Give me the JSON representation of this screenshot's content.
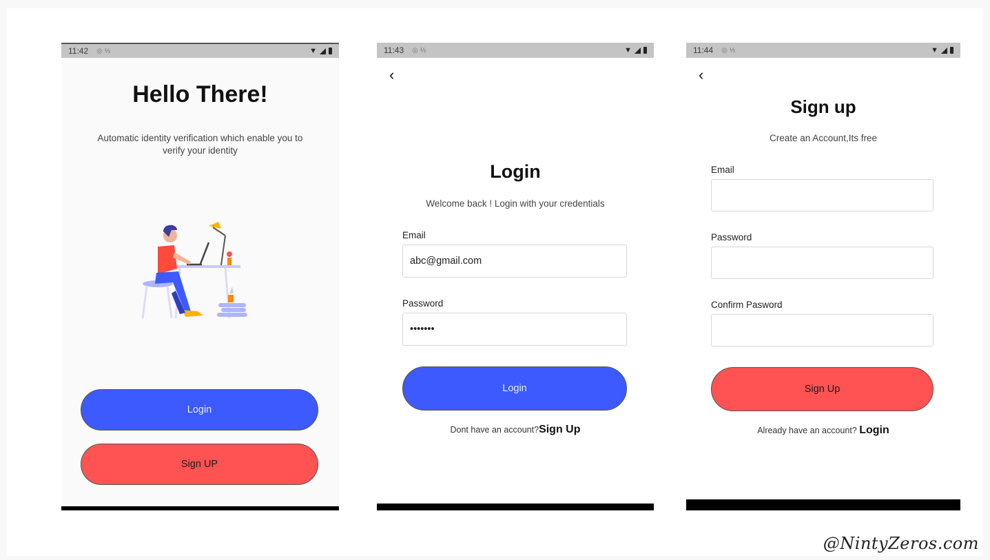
{
  "screens": [
    {
      "status_time": "11:42",
      "title": "Hello There!",
      "subtitle_line1": "Automatic identity verification which enable you to",
      "subtitle_line2": "verify your identity",
      "login_button": "Login",
      "signup_button": "Sign UP"
    },
    {
      "status_time": "11:43",
      "title": "Login",
      "subtitle": "Welcome back ! Login with your credentials",
      "email_label": "Email",
      "email_value": "abc@gmail.com",
      "password_label": "Password",
      "password_value": "•••••••",
      "login_button": "Login",
      "footer_text": "Dont have an account?",
      "footer_link": "Sign Up"
    },
    {
      "status_time": "11:44",
      "title": "Sign up",
      "subtitle": "Create an Account,Its free",
      "email_label": "Email",
      "password_label": "Password",
      "confirm_label": "Confirm Pasword",
      "signup_button": "Sign Up",
      "footer_text": "Already have an account?",
      "footer_link": "Login"
    }
  ],
  "watermark": "@NintyZeros.com",
  "colors": {
    "blue_button": "#3d5afe",
    "red_button": "#ff5252",
    "status_bar": "#c4c4c4"
  },
  "icons": {
    "back": "chevron-left-icon",
    "battery": "battery-icon",
    "signal": "signal-icon",
    "wifi": "wifi-icon"
  }
}
